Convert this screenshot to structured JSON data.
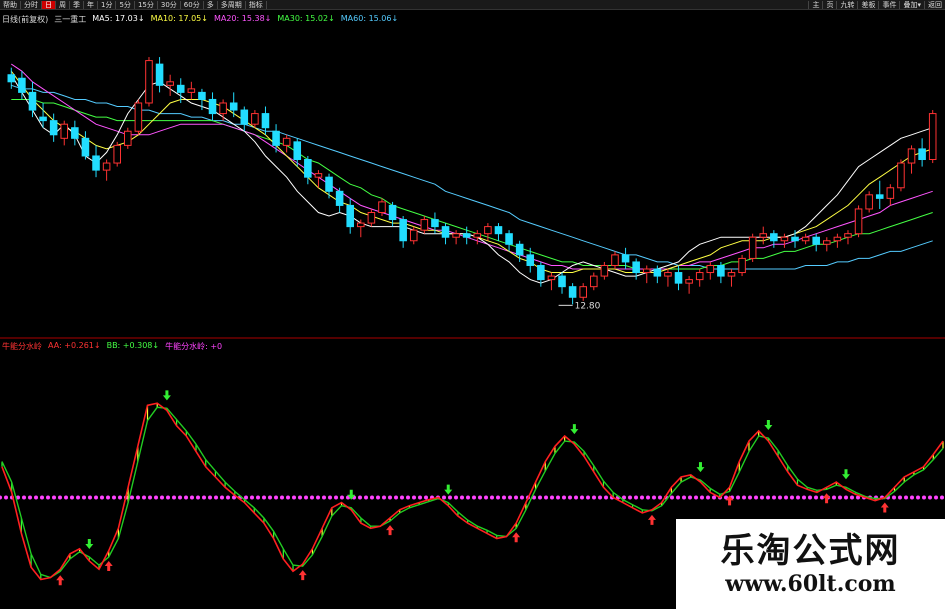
{
  "toolbar": {
    "left": [
      "帮助",
      "分时",
      "日",
      "周",
      "季",
      "年",
      "1分",
      "5分",
      "15分",
      "30分",
      "60分",
      "多",
      "多周期",
      "指标"
    ],
    "active_index": 2,
    "right": [
      "主",
      "页",
      "九转",
      "差板",
      "事件",
      "叠加▾",
      "返回"
    ]
  },
  "legend_top": [
    {
      "text": "日线(前复权)",
      "color": "#dddddd"
    },
    {
      "text": "三一重工",
      "color": "#dddddd"
    },
    {
      "text": "MA5: 17.03↓",
      "color": "#ffffff"
    },
    {
      "text": "MA10: 17.05↓",
      "color": "#ffff44"
    },
    {
      "text": "MA20: 15.38↓",
      "color": "#ff55ff"
    },
    {
      "text": "MA30: 15.02↓",
      "color": "#44ff44"
    },
    {
      "text": "MA60: 15.06↓",
      "color": "#55ccff"
    }
  ],
  "legend_bottom": [
    {
      "text": "牛能分水岭",
      "color": "#ff3333"
    },
    {
      "text": "AA: +0.261↓",
      "color": "#ff3333"
    },
    {
      "text": "BB: +0.308↓",
      "color": "#44ff44"
    },
    {
      "text": "牛能分水岭: +0",
      "color": "#ff44ff"
    }
  ],
  "colors": {
    "up": "#ff3333",
    "down": "#22ddff",
    "ma5": "#ffffff",
    "ma10": "#ffff44",
    "ma20": "#ff55ff",
    "ma30": "#44ff44",
    "ma60": "#55ccff",
    "aa": "#ff2020",
    "bb": "#22cc22",
    "zero": "#ff44ff"
  },
  "watermark": {
    "title": "乐淘公式网",
    "url": "www.60lt.com"
  },
  "chart_data": [
    {
      "type": "candlestick",
      "low_label": "12.80",
      "ylim": [
        12.3,
        20.0
      ],
      "candles": [
        [
          19.3,
          19.5,
          19.1,
          18.9
        ],
        [
          19.2,
          19.4,
          18.8,
          18.6
        ],
        [
          18.8,
          19.1,
          18.3,
          18.1
        ],
        [
          18.1,
          18.5,
          18.0,
          17.8
        ],
        [
          18.0,
          18.2,
          17.6,
          17.4
        ],
        [
          17.5,
          18.0,
          17.9,
          17.3
        ],
        [
          17.8,
          18.0,
          17.5,
          17.3
        ],
        [
          17.5,
          17.7,
          17.0,
          16.9
        ],
        [
          17.0,
          17.3,
          16.6,
          16.4
        ],
        [
          16.6,
          16.9,
          16.8,
          16.3
        ],
        [
          16.8,
          17.4,
          17.3,
          16.7
        ],
        [
          17.3,
          17.8,
          17.7,
          17.2
        ],
        [
          17.7,
          18.6,
          18.5,
          17.6
        ],
        [
          18.5,
          19.8,
          19.7,
          18.4
        ],
        [
          19.6,
          19.8,
          19.0,
          18.8
        ],
        [
          19.0,
          19.3,
          19.1,
          18.7
        ],
        [
          19.0,
          19.2,
          18.8,
          18.5
        ],
        [
          18.8,
          19.1,
          18.9,
          18.6
        ],
        [
          18.8,
          18.9,
          18.6,
          18.3
        ],
        [
          18.6,
          18.8,
          18.2,
          18.0
        ],
        [
          18.2,
          18.6,
          18.5,
          18.0
        ],
        [
          18.5,
          18.8,
          18.3,
          18.1
        ],
        [
          18.3,
          18.4,
          17.9,
          17.7
        ],
        [
          17.9,
          18.3,
          18.2,
          17.8
        ],
        [
          18.2,
          18.4,
          17.8,
          17.6
        ],
        [
          17.7,
          17.9,
          17.3,
          17.1
        ],
        [
          17.3,
          17.6,
          17.5,
          17.1
        ],
        [
          17.4,
          17.5,
          16.9,
          16.7
        ],
        [
          16.9,
          17.0,
          16.4,
          16.2
        ],
        [
          16.4,
          16.6,
          16.5,
          16.1
        ],
        [
          16.4,
          16.5,
          16.0,
          15.8
        ],
        [
          16.0,
          16.1,
          15.6,
          15.4
        ],
        [
          15.6,
          15.8,
          15.0,
          14.8
        ],
        [
          15.0,
          15.2,
          15.1,
          14.7
        ],
        [
          15.1,
          15.5,
          15.4,
          15.0
        ],
        [
          15.4,
          15.8,
          15.7,
          15.3
        ],
        [
          15.6,
          15.7,
          15.2,
          15.0
        ],
        [
          15.2,
          15.3,
          14.6,
          14.4
        ],
        [
          14.6,
          15.0,
          14.9,
          14.5
        ],
        [
          14.9,
          15.3,
          15.2,
          14.8
        ],
        [
          15.2,
          15.4,
          15.0,
          14.8
        ],
        [
          15.0,
          15.1,
          14.7,
          14.5
        ],
        [
          14.7,
          14.9,
          14.8,
          14.5
        ],
        [
          14.8,
          15.0,
          14.7,
          14.5
        ],
        [
          14.7,
          14.9,
          14.8,
          14.5
        ],
        [
          14.8,
          15.1,
          15.0,
          14.6
        ],
        [
          15.0,
          15.1,
          14.8,
          14.6
        ],
        [
          14.8,
          14.9,
          14.5,
          14.3
        ],
        [
          14.5,
          14.6,
          14.2,
          14.0
        ],
        [
          14.2,
          14.4,
          13.9,
          13.7
        ],
        [
          13.9,
          14.0,
          13.5,
          13.3
        ],
        [
          13.5,
          13.7,
          13.6,
          13.2
        ],
        [
          13.6,
          13.7,
          13.3,
          13.1
        ],
        [
          13.3,
          13.4,
          13.0,
          12.8
        ],
        [
          13.0,
          13.4,
          13.3,
          12.9
        ],
        [
          13.3,
          13.7,
          13.6,
          13.2
        ],
        [
          13.6,
          14.0,
          13.9,
          13.5
        ],
        [
          13.9,
          14.3,
          14.2,
          13.8
        ],
        [
          14.2,
          14.4,
          14.0,
          13.8
        ],
        [
          14.0,
          14.1,
          13.7,
          13.5
        ],
        [
          13.7,
          13.9,
          13.8,
          13.4
        ],
        [
          13.8,
          13.9,
          13.6,
          13.4
        ],
        [
          13.6,
          13.8,
          13.7,
          13.3
        ],
        [
          13.7,
          13.9,
          13.4,
          13.2
        ],
        [
          13.4,
          13.6,
          13.5,
          13.1
        ],
        [
          13.5,
          13.8,
          13.7,
          13.3
        ],
        [
          13.7,
          14.0,
          13.9,
          13.5
        ],
        [
          13.9,
          14.0,
          13.6,
          13.4
        ],
        [
          13.6,
          13.8,
          13.7,
          13.3
        ],
        [
          13.7,
          14.2,
          14.1,
          13.6
        ],
        [
          14.1,
          14.8,
          14.7,
          14.0
        ],
        [
          14.7,
          15.0,
          14.8,
          14.5
        ],
        [
          14.8,
          14.9,
          14.6,
          14.4
        ],
        [
          14.6,
          14.8,
          14.7,
          14.4
        ],
        [
          14.7,
          14.9,
          14.6,
          14.4
        ],
        [
          14.6,
          14.8,
          14.7,
          14.5
        ],
        [
          14.7,
          14.8,
          14.5,
          14.3
        ],
        [
          14.5,
          14.7,
          14.6,
          14.3
        ],
        [
          14.6,
          14.8,
          14.7,
          14.4
        ],
        [
          14.7,
          14.9,
          14.8,
          14.5
        ],
        [
          14.8,
          15.6,
          15.5,
          14.7
        ],
        [
          15.5,
          16.0,
          15.9,
          15.4
        ],
        [
          15.9,
          16.3,
          15.8,
          15.5
        ],
        [
          15.8,
          16.2,
          16.1,
          15.6
        ],
        [
          16.1,
          16.9,
          16.8,
          16.0
        ],
        [
          16.8,
          17.3,
          17.2,
          16.5
        ],
        [
          17.2,
          17.5,
          16.9,
          16.7
        ],
        [
          16.9,
          18.3,
          18.2,
          16.8
        ]
      ],
      "ma5": [
        19.3,
        18.8,
        18.3,
        17.8,
        17.6,
        17.9,
        17.6,
        17.0,
        16.8,
        17.1,
        17.6,
        18.2,
        18.6,
        19.0,
        19.1,
        18.9,
        18.7,
        18.5,
        18.4,
        18.3,
        18.1,
        17.9,
        17.7,
        17.4,
        17.0,
        16.7,
        16.4,
        16.0,
        15.7,
        15.4,
        15.3,
        15.4,
        15.3,
        15.1,
        15.0,
        15.0,
        15.0,
        15.0,
        14.9,
        14.8,
        14.8,
        14.8,
        14.8,
        14.8,
        14.7,
        14.5,
        14.2,
        14.0,
        13.7,
        13.5,
        13.4,
        13.5,
        13.7,
        13.9,
        14.0,
        13.9,
        13.8,
        13.7,
        13.6,
        13.6,
        13.7,
        13.8,
        13.9,
        14.0,
        14.3,
        14.5,
        14.6,
        14.7,
        14.7,
        14.7,
        14.7,
        14.7,
        14.7,
        14.7,
        14.8,
        15.0,
        15.3,
        15.6,
        15.9,
        16.3,
        16.7,
        16.9,
        17.1,
        17.3,
        17.5,
        17.6,
        17.7,
        17.8
      ],
      "ma10": [
        19.4,
        19.0,
        18.6,
        18.3,
        18.0,
        17.8,
        17.7,
        17.5,
        17.3,
        17.2,
        17.3,
        17.4,
        17.6,
        17.9,
        18.2,
        18.5,
        18.6,
        18.6,
        18.6,
        18.5,
        18.4,
        18.2,
        18.0,
        17.8,
        17.6,
        17.3,
        17.0,
        16.7,
        16.4,
        16.1,
        15.9,
        15.7,
        15.6,
        15.4,
        15.3,
        15.2,
        15.1,
        15.1,
        15.0,
        14.9,
        14.9,
        14.8,
        14.8,
        14.8,
        14.7,
        14.6,
        14.5,
        14.3,
        14.1,
        14.0,
        13.8,
        13.7,
        13.7,
        13.7,
        13.8,
        13.8,
        13.8,
        13.8,
        13.7,
        13.7,
        13.7,
        13.7,
        13.8,
        13.9,
        14.0,
        14.1,
        14.2,
        14.4,
        14.5,
        14.6,
        14.6,
        14.6,
        14.7,
        14.7,
        14.8,
        14.9,
        15.0,
        15.2,
        15.4,
        15.6,
        15.9,
        16.2,
        16.4,
        16.6,
        16.8,
        17.0,
        17.1,
        17.2
      ],
      "ma20": [
        19.6,
        19.4,
        19.1,
        18.9,
        18.7,
        18.5,
        18.3,
        18.1,
        17.9,
        17.8,
        17.7,
        17.6,
        17.6,
        17.6,
        17.7,
        17.8,
        17.9,
        17.9,
        17.9,
        17.9,
        17.9,
        17.8,
        17.7,
        17.6,
        17.4,
        17.2,
        17.0,
        16.8,
        16.6,
        16.4,
        16.2,
        16.0,
        15.8,
        15.6,
        15.5,
        15.4,
        15.3,
        15.2,
        15.1,
        15.0,
        14.9,
        14.9,
        14.8,
        14.7,
        14.6,
        14.5,
        14.4,
        14.3,
        14.2,
        14.1,
        14.0,
        13.9,
        13.9,
        13.8,
        13.8,
        13.8,
        13.8,
        13.8,
        13.8,
        13.8,
        13.8,
        13.8,
        13.8,
        13.9,
        13.9,
        14.0,
        14.0,
        14.1,
        14.2,
        14.3,
        14.4,
        14.4,
        14.5,
        14.5,
        14.6,
        14.7,
        14.8,
        14.9,
        15.0,
        15.1,
        15.2,
        15.3,
        15.4,
        15.6,
        15.7,
        15.8,
        15.9,
        16.0
      ],
      "ma30": [
        18.6,
        18.6,
        18.6,
        18.5,
        18.5,
        18.4,
        18.3,
        18.2,
        18.1,
        18.1,
        18.0,
        18.0,
        18.0,
        18.0,
        18.0,
        18.0,
        18.0,
        18.0,
        18.0,
        18.0,
        17.9,
        17.8,
        17.7,
        17.6,
        17.5,
        17.4,
        17.3,
        17.1,
        16.9,
        16.8,
        16.6,
        16.4,
        16.2,
        16.1,
        15.9,
        15.8,
        15.6,
        15.5,
        15.4,
        15.3,
        15.2,
        15.1,
        15.0,
        14.9,
        14.8,
        14.7,
        14.6,
        14.5,
        14.4,
        14.3,
        14.2,
        14.1,
        14.0,
        14.0,
        13.9,
        13.9,
        13.9,
        13.9,
        13.9,
        13.8,
        13.8,
        13.8,
        13.8,
        13.8,
        13.8,
        13.8,
        13.9,
        13.9,
        14.0,
        14.0,
        14.1,
        14.1,
        14.2,
        14.3,
        14.3,
        14.4,
        14.5,
        14.5,
        14.6,
        14.7,
        14.8,
        14.8,
        14.9,
        15.0,
        15.1,
        15.2,
        15.3,
        15.4
      ],
      "ma60": [
        19.0,
        18.9,
        18.9,
        18.8,
        18.8,
        18.7,
        18.6,
        18.6,
        18.5,
        18.5,
        18.4,
        18.4,
        18.3,
        18.3,
        18.2,
        18.2,
        18.2,
        18.1,
        18.1,
        18.0,
        18.0,
        17.9,
        17.9,
        17.8,
        17.7,
        17.7,
        17.6,
        17.5,
        17.4,
        17.3,
        17.2,
        17.1,
        17.0,
        16.9,
        16.8,
        16.7,
        16.6,
        16.5,
        16.4,
        16.3,
        16.2,
        16.0,
        15.9,
        15.8,
        15.7,
        15.6,
        15.5,
        15.4,
        15.2,
        15.1,
        15.0,
        14.9,
        14.8,
        14.7,
        14.6,
        14.5,
        14.4,
        14.3,
        14.2,
        14.2,
        14.1,
        14.0,
        14.0,
        13.9,
        13.9,
        13.9,
        13.8,
        13.8,
        13.8,
        13.8,
        13.8,
        13.8,
        13.8,
        13.8,
        13.8,
        13.9,
        13.9,
        13.9,
        14.0,
        14.0,
        14.1,
        14.1,
        14.2,
        14.3,
        14.3,
        14.4,
        14.5,
        14.6
      ]
    },
    {
      "type": "line",
      "ylim": [
        -1.0,
        1.0
      ],
      "aa": [
        0.3,
        0.05,
        -0.35,
        -0.68,
        -0.8,
        -0.78,
        -0.7,
        -0.55,
        -0.5,
        -0.62,
        -0.7,
        -0.52,
        -0.3,
        0.1,
        0.5,
        0.9,
        0.92,
        0.85,
        0.7,
        0.6,
        0.45,
        0.3,
        0.2,
        0.1,
        0.02,
        -0.05,
        -0.15,
        -0.25,
        -0.4,
        -0.6,
        -0.72,
        -0.65,
        -0.5,
        -0.3,
        -0.1,
        -0.05,
        -0.12,
        -0.25,
        -0.3,
        -0.28,
        -0.2,
        -0.12,
        -0.08,
        -0.05,
        -0.02,
        0.0,
        -0.08,
        -0.18,
        -0.25,
        -0.3,
        -0.35,
        -0.4,
        -0.38,
        -0.25,
        -0.05,
        0.15,
        0.35,
        0.5,
        0.6,
        0.52,
        0.4,
        0.25,
        0.1,
        0.0,
        -0.05,
        -0.1,
        -0.15,
        -0.12,
        -0.05,
        0.1,
        0.2,
        0.22,
        0.15,
        0.05,
        0.0,
        0.1,
        0.35,
        0.55,
        0.65,
        0.55,
        0.4,
        0.25,
        0.12,
        0.08,
        0.05,
        0.1,
        0.15,
        0.08,
        0.03,
        0.0,
        -0.03,
        0.0,
        0.1,
        0.2,
        0.25,
        0.3,
        0.42,
        0.55
      ],
      "bb": [
        0.35,
        0.15,
        -0.2,
        -0.55,
        -0.75,
        -0.78,
        -0.72,
        -0.6,
        -0.53,
        -0.58,
        -0.66,
        -0.58,
        -0.4,
        -0.05,
        0.35,
        0.75,
        0.88,
        0.87,
        0.76,
        0.65,
        0.52,
        0.37,
        0.26,
        0.15,
        0.06,
        -0.02,
        -0.1,
        -0.2,
        -0.33,
        -0.5,
        -0.66,
        -0.67,
        -0.56,
        -0.38,
        -0.18,
        -0.08,
        -0.1,
        -0.2,
        -0.28,
        -0.28,
        -0.23,
        -0.15,
        -0.1,
        -0.07,
        -0.04,
        -0.01,
        -0.05,
        -0.14,
        -0.22,
        -0.28,
        -0.32,
        -0.37,
        -0.38,
        -0.3,
        -0.12,
        0.08,
        0.26,
        0.43,
        0.55,
        0.54,
        0.45,
        0.31,
        0.16,
        0.05,
        -0.02,
        -0.07,
        -0.12,
        -0.13,
        -0.08,
        0.04,
        0.15,
        0.2,
        0.17,
        0.09,
        0.03,
        0.06,
        0.25,
        0.45,
        0.6,
        0.58,
        0.46,
        0.31,
        0.18,
        0.1,
        0.07,
        0.08,
        0.12,
        0.1,
        0.05,
        0.01,
        -0.01,
        -0.01,
        0.06,
        0.15,
        0.22,
        0.27,
        0.37,
        0.48
      ]
    }
  ]
}
